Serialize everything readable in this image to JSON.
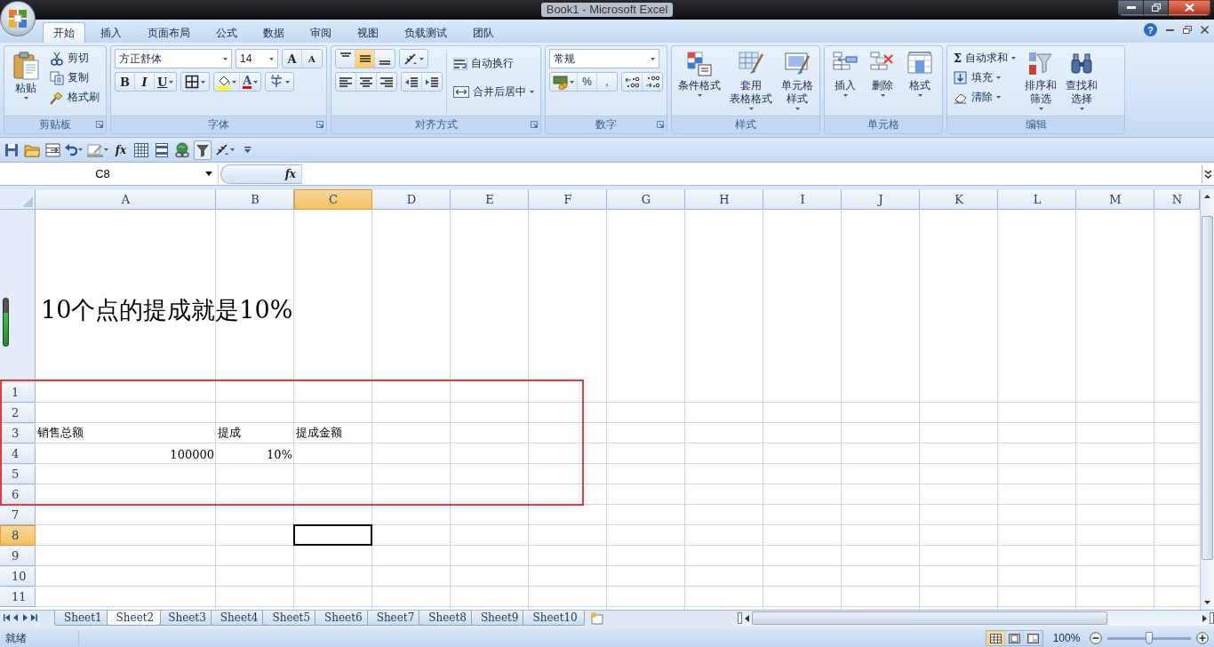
{
  "window": {
    "title": "Book1 - Microsoft Excel"
  },
  "ribbon": {
    "tabs": [
      {
        "label": "开始",
        "selected": true
      },
      {
        "label": "插入",
        "selected": false
      },
      {
        "label": "页面布局",
        "selected": false
      },
      {
        "label": "公式",
        "selected": false
      },
      {
        "label": "数据",
        "selected": false
      },
      {
        "label": "审阅",
        "selected": false
      },
      {
        "label": "视图",
        "selected": false
      },
      {
        "label": "负载测试",
        "selected": false
      },
      {
        "label": "团队",
        "selected": false
      }
    ],
    "help_symbol": "?",
    "groups": [
      {
        "kind": "clipboard",
        "label": "剪贴板",
        "large_button": {
          "label": "粘贴"
        },
        "small_buttons": [
          {
            "label": "剪切"
          },
          {
            "label": "复制"
          },
          {
            "label": "格式刷"
          }
        ]
      },
      {
        "kind": "font",
        "label": "字体",
        "font_name": "方正舒体",
        "font_size": "14",
        "grow_symbol": "A",
        "shrink_symbol": "A",
        "style_buttons": [
          {
            "symbol": "B"
          },
          {
            "symbol": "I"
          },
          {
            "symbol": "U"
          }
        ],
        "font_color_symbol": "A"
      },
      {
        "kind": "alignment",
        "label": "对齐方式",
        "vertical_align": [
          {
            "selected": false
          },
          {
            "selected": true
          },
          {
            "selected": false
          }
        ],
        "horizontal_align": [
          {
            "selected": false
          },
          {
            "selected": false
          },
          {
            "selected": false
          }
        ],
        "wrap_text": "自动换行",
        "merge_center": "合并后居中"
      },
      {
        "kind": "number",
        "label": "数字",
        "format": "常规",
        "symbols": [
          "%",
          ","
        ]
      },
      {
        "kind": "styles",
        "label": "样式",
        "large_buttons": [
          {
            "lines": [
              "条件格式"
            ]
          },
          {
            "lines": [
              "套用",
              "表格格式"
            ]
          },
          {
            "lines": [
              "单元格",
              "样式"
            ]
          }
        ]
      },
      {
        "kind": "cells",
        "label": "单元格",
        "large_buttons": [
          {
            "lines": [
              "插入"
            ]
          },
          {
            "lines": [
              "删除"
            ]
          },
          {
            "lines": [
              "格式"
            ]
          }
        ]
      },
      {
        "kind": "editing",
        "label": "编辑",
        "small_buttons": [
          {
            "label": "自动求和",
            "symbol": "Σ"
          },
          {
            "label": "填充"
          },
          {
            "label": "清除"
          }
        ],
        "large_buttons": [
          {
            "lines": [
              "排序和",
              "筛选"
            ]
          },
          {
            "lines": [
              "查找和",
              "选择"
            ]
          }
        ]
      }
    ]
  },
  "quick_access_toolbar": {
    "function_symbol": "fx"
  },
  "formula_bar": {
    "name_box": "C8",
    "function_symbol": "fx"
  },
  "sheet": {
    "columns": [
      {
        "label": "A",
        "selected": false
      },
      {
        "label": "B",
        "selected": false
      },
      {
        "label": "C",
        "selected": true
      },
      {
        "label": "D",
        "selected": false
      },
      {
        "label": "E",
        "selected": false
      },
      {
        "label": "F",
        "selected": false
      },
      {
        "label": "G",
        "selected": false
      },
      {
        "label": "H",
        "selected": false
      },
      {
        "label": "I",
        "selected": false
      },
      {
        "label": "J",
        "selected": false
      },
      {
        "label": "K",
        "selected": false
      },
      {
        "label": "L",
        "selected": false
      },
      {
        "label": "M",
        "selected": false
      },
      {
        "label": "N",
        "selected": false
      }
    ],
    "text_box": {
      "text": "10个点的提成就是10%"
    },
    "rows": [
      {
        "label": "1",
        "selected": false
      },
      {
        "label": "2",
        "selected": false
      },
      {
        "label": "3",
        "selected": false,
        "cells": [
          {
            "text": "销售总额",
            "kind": "text"
          },
          {
            "text": "提成",
            "kind": "text"
          },
          {
            "text": "提成金额",
            "kind": "text"
          }
        ]
      },
      {
        "label": "4",
        "selected": false,
        "cells": [
          {
            "text": "100000",
            "kind": "number"
          },
          {
            "text": "10%",
            "kind": "number"
          }
        ]
      },
      {
        "label": "5",
        "selected": false
      },
      {
        "label": "6",
        "selected": false
      },
      {
        "label": "7",
        "selected": false
      },
      {
        "label": "8",
        "selected": true
      },
      {
        "label": "9",
        "selected": false
      },
      {
        "label": "10",
        "selected": false
      },
      {
        "label": "11",
        "selected": false
      }
    ]
  },
  "sheet_tabs": [
    {
      "label": "Sheet1",
      "selected": false
    },
    {
      "label": "Sheet2",
      "selected": true
    },
    {
      "label": "Sheet3",
      "selected": false
    },
    {
      "label": "Sheet4",
      "selected": false
    },
    {
      "label": "Sheet5",
      "selected": false
    },
    {
      "label": "Sheet6",
      "selected": false
    },
    {
      "label": "Sheet7",
      "selected": false
    },
    {
      "label": "Sheet8",
      "selected": false
    },
    {
      "label": "Sheet9",
      "selected": false
    },
    {
      "label": "Sheet10",
      "selected": false
    }
  ],
  "status_bar": {
    "status": "就绪",
    "views": [
      {
        "selected": true
      },
      {
        "selected": false
      },
      {
        "selected": false
      }
    ],
    "zoom": "100%",
    "zoom_slider": {
      "level": 0.5
    }
  }
}
